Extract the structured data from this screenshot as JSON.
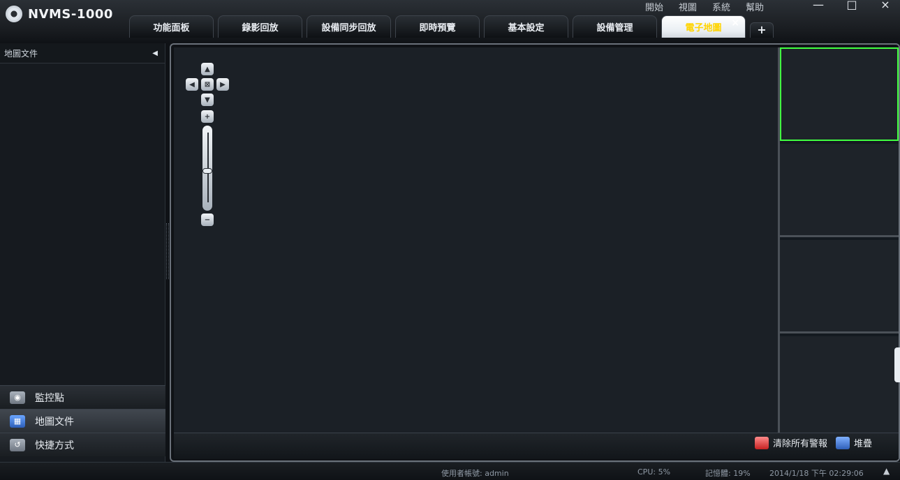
{
  "app": {
    "title": "NVMS-1000"
  },
  "menu": {
    "items": [
      "開始",
      "視圖",
      "系統",
      "幫助"
    ]
  },
  "tabs": [
    {
      "label": "功能面板"
    },
    {
      "label": "錄影回放"
    },
    {
      "label": "設備同步回放"
    },
    {
      "label": "即時預覽"
    },
    {
      "label": "基本設定"
    },
    {
      "label": "設備管理"
    },
    {
      "label": "電子地圖",
      "active": true
    }
  ],
  "left_panel": {
    "header": "地圖文件",
    "tabs": [
      {
        "label": "監控點",
        "icon": "camera-icon"
      },
      {
        "label": "地圖文件",
        "icon": "map-icon",
        "active": true
      },
      {
        "label": "快捷方式",
        "icon": "shortcut-icon"
      }
    ]
  },
  "map_footer": {
    "actions": [
      {
        "label": "清除所有警報",
        "icon": "clear-alarm-icon"
      },
      {
        "label": "堆疊",
        "icon": "stack-icon"
      }
    ]
  },
  "status_bar": {
    "user": "使用者帳號: admin",
    "cpu": "CPU: 5%",
    "memory": "記憶體: 19%",
    "datetime": "2014/1/18 下午 02:29:06"
  },
  "colors": {
    "accent_active_tab_text": "#ffd400",
    "selected_cell_border": "#41ff41"
  }
}
